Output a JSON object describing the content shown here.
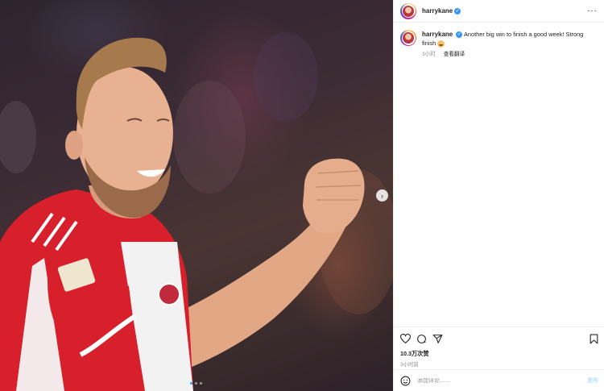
{
  "post": {
    "username": "harrykane",
    "verified_mark": "✓",
    "more_glyph": "···",
    "next_glyph": "›",
    "caption_text": "Another big win to finish a good week! Strong finish",
    "caption_emoji": "smiling-face-emoji",
    "caption_time": "3小时",
    "translate_label": "查看翻译",
    "likes": "10.3万次赞",
    "time_ago": "3小时前",
    "carousel_dots": 3,
    "carousel_active_index": 0
  },
  "comment": {
    "placeholder": "添加评论……",
    "post_label": "发布"
  },
  "icons": {
    "like": "heart-icon",
    "comment": "comment-icon",
    "share": "send-icon",
    "save": "bookmark-icon",
    "emoji": "smiley-icon",
    "next": "chevron-right-icon"
  },
  "colors": {
    "verified": "#3897f0",
    "link_disabled": "#b2dffc",
    "jersey_red": "#d8202c",
    "muted_text": "#8e8e8e"
  }
}
